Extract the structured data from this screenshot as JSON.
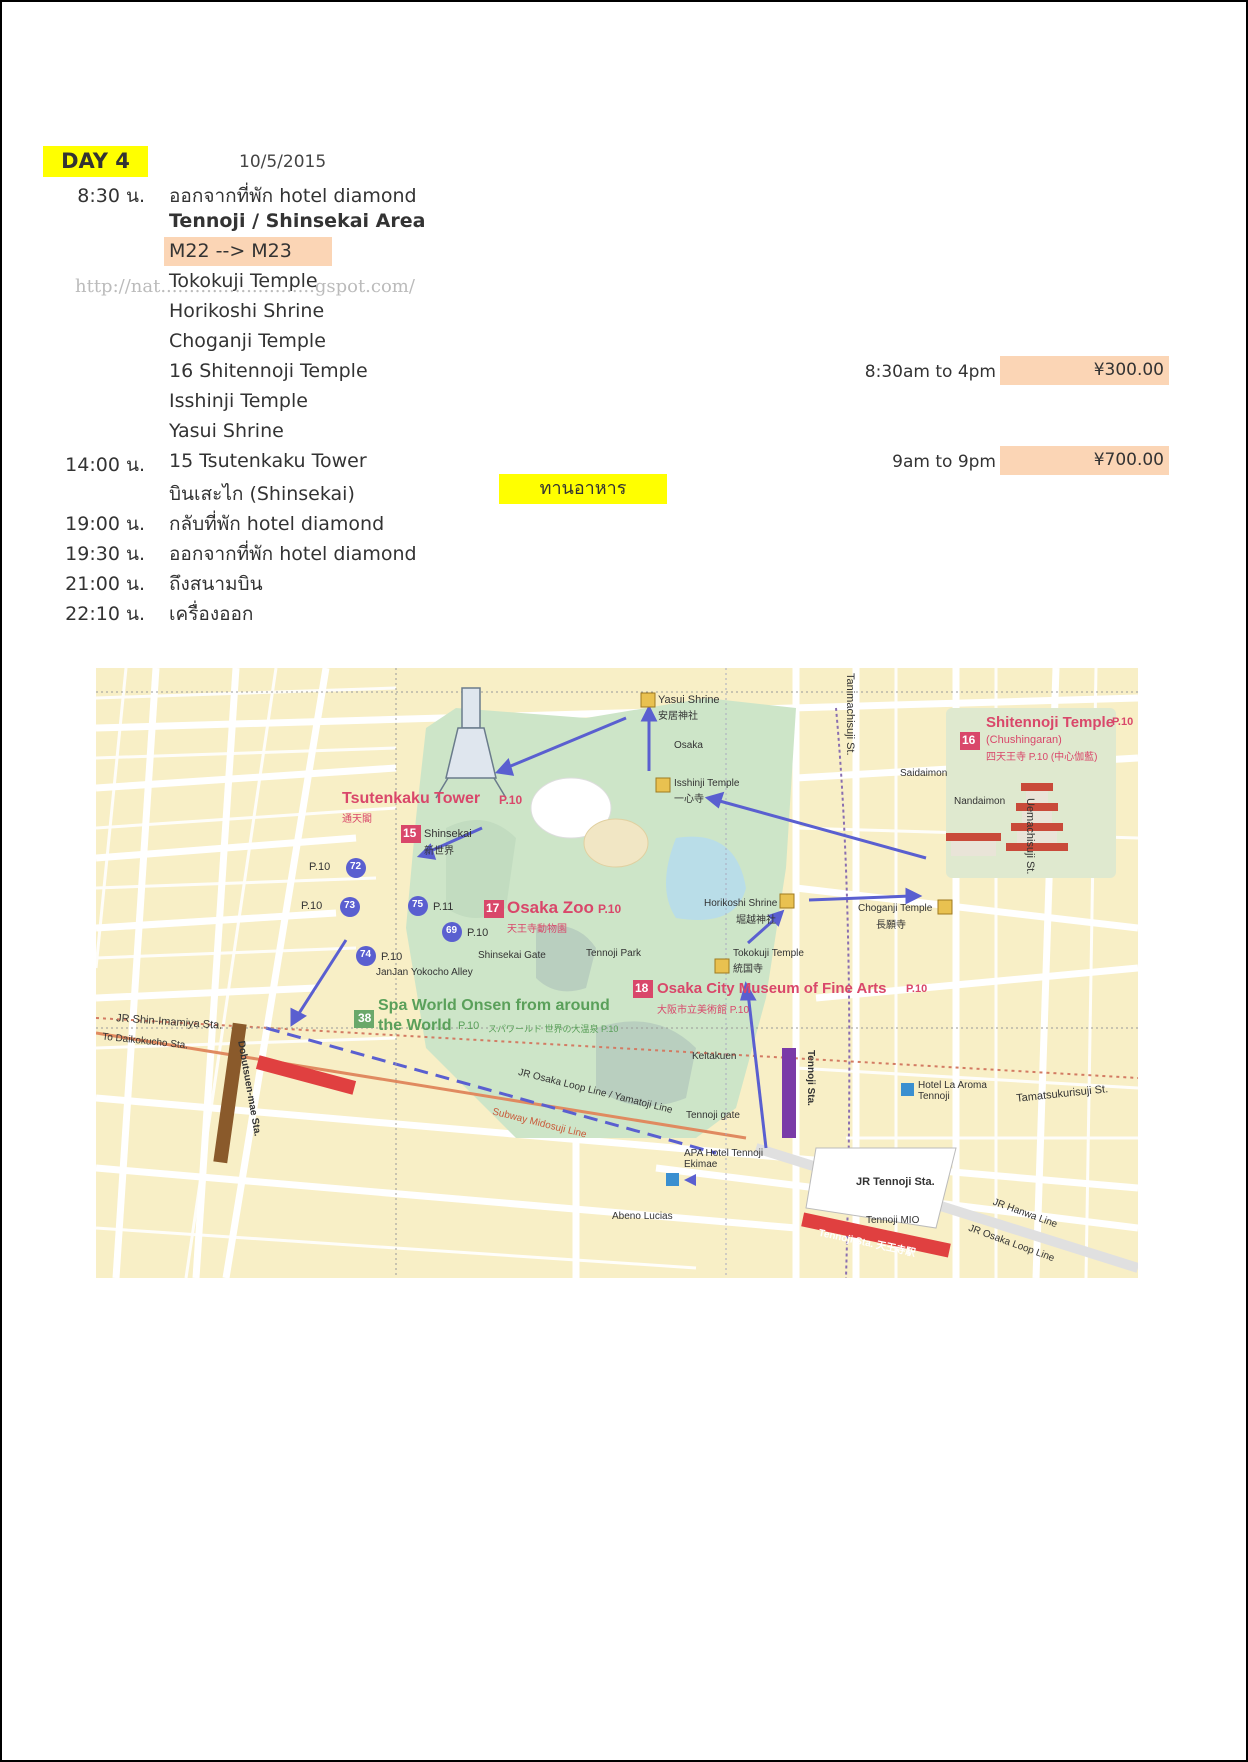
{
  "day_label": "DAY 4",
  "date": "10/5/2015",
  "watermark": "http://nat...........................gspot.com/",
  "area_title": "Tennoji / Shinsekai Area",
  "route": "M22 --> M23",
  "meal_label": "ทานอาหาร",
  "schedule": [
    {
      "time": "8:30 น.",
      "activity": "ออกจากที่พัก hotel diamond"
    },
    {
      "time": "",
      "activity": "Tokokuji Temple"
    },
    {
      "time": "",
      "activity": "Horikoshi Shrine"
    },
    {
      "time": "",
      "activity": "Choganji Temple"
    },
    {
      "time": "",
      "activity": "16 Shitennoji Temple",
      "hours": "8:30am to 4pm",
      "price": "¥300.00"
    },
    {
      "time": "",
      "activity": "Isshinji Temple"
    },
    {
      "time": "",
      "activity": "Yasui Shrine"
    },
    {
      "time": "14:00 น.",
      "activity": "15 Tsutenkaku Tower",
      "hours": "9am to 9pm",
      "price": "¥700.00"
    },
    {
      "time": "",
      "activity": "บินเสะไก (Shinsekai)"
    },
    {
      "time": "19:00 น.",
      "activity": "กลับที่พัก hotel diamond"
    },
    {
      "time": "19:30 น.",
      "activity": "ออกจากที่พัก hotel diamond"
    },
    {
      "time": "21:00 น.",
      "activity": "ถึงสนามบิน"
    },
    {
      "time": "22:10 น.",
      "activity": "เครื่องออก"
    }
  ],
  "map": {
    "colors": {
      "bg": "#f8efc6",
      "road": "#ffffff",
      "park": "#cde5c8",
      "arrow": "#5a5fd0",
      "accent": "#d9476a"
    },
    "pois": [
      {
        "num": "15",
        "name": "Tsutenkaku Tower",
        "page": "P.10",
        "jp": "通天閣"
      },
      {
        "num": "16",
        "name": "Shitennoji Temple",
        "page": "P.10",
        "sub": "(Chushingaran)",
        "jp": "四天王寺 P.10 (中心伽藍)"
      },
      {
        "num": "17",
        "name": "Osaka Zoo",
        "page": "P.10",
        "jp": "天王寺動物園"
      },
      {
        "num": "18",
        "name": "Osaka City Museum of Fine Arts",
        "page": "P.10",
        "jp": "大阪市立美術館 P.10"
      },
      {
        "num": "38",
        "name": "Spa World Onsen from around the World",
        "page": "P.10",
        "jp": "スパワールド 世界の大温泉 P.10"
      }
    ],
    "labels": {
      "yasui": "Yasui Shrine",
      "yasui_jp": "安居神社",
      "isshinji": "Isshinji Temple",
      "isshinji_jp": "一心寺",
      "horikoshi": "Horikoshi Shrine",
      "horikoshi_jp": "堀越神社",
      "choganji": "Choganji Temple",
      "choganji_jp": "長願寺",
      "tokokuji": "Tokokuji Temple",
      "tokokuji_jp": "統国寺",
      "shinsekai": "Shinsekai",
      "shinsekai_jp": "新世界",
      "shinsekai_gate": "Shinsekai Gate",
      "tennoji_park": "Tennoji Park",
      "keitakuen": "Keitakuen",
      "tennoji_gate": "Tennoji gate",
      "apa": "APA Hotel Tennoji Ekimae",
      "abeno": "Abeno Lucias",
      "jr_tennoji": "JR Tennoji Sta.",
      "tennoji_mio": "Tennoji MIO",
      "hotel_la_aroma": "Hotel La Aroma Tennoji",
      "saidaimon": "Saidaimon",
      "nandaimon": "Nandaimon",
      "osaka": "Osaka",
      "tamatsukurisuji": "Tamatsukurisuji St.",
      "uemachisuji": "Uemachisuji St.",
      "tanimachisuji": "Tanimachisuji St.",
      "jr_shin_imamiya": "JR Shin-Imamiya Sta.",
      "to_daikokucho": "To Daikokucho Sta.",
      "loop_line": "JR Osaka Loop Line / Yamatoji Line",
      "midosuji": "Subway Midosuji Line",
      "jr_hanwa": "JR Hanwa Line",
      "jr_osaka_loop": "JR Osaka Loop Line",
      "tennoji_sta": "Tennoji Sta.",
      "dobutsuen": "Dobutsuen-mae Sta.",
      "jan_jan": "JanJan Yokocho Alley",
      "tennoji_sta_red": "Tennoji Sta. 天王寺駅"
    },
    "bus_stops": [
      {
        "num": "72",
        "page": "P.10"
      },
      {
        "num": "73",
        "page": "P.10"
      },
      {
        "num": "75",
        "page": "P.11"
      },
      {
        "num": "69",
        "page": "P.10"
      },
      {
        "num": "74",
        "page": "P.10"
      }
    ]
  }
}
